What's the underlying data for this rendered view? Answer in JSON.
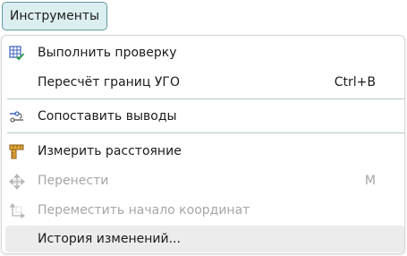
{
  "menubar": {
    "tools_label": "Инструменты"
  },
  "menu": {
    "items": [
      {
        "label": "Выполнить проверку",
        "shortcut": "",
        "icon": "table-check-icon",
        "enabled": true
      },
      {
        "label": "Пересчёт границ УГО",
        "shortcut": "Ctrl+B",
        "icon": "",
        "enabled": true
      },
      {
        "label": "Сопоставить выводы",
        "shortcut": "",
        "icon": "link-pins-icon",
        "enabled": true
      },
      {
        "label": "Измерить расстояние",
        "shortcut": "",
        "icon": "ruler-icon",
        "enabled": true
      },
      {
        "label": "Перенести",
        "shortcut": "M",
        "icon": "move-icon",
        "enabled": false
      },
      {
        "label": "Переместить начало координат",
        "shortcut": "",
        "icon": "origin-icon",
        "enabled": false
      },
      {
        "label": "История изменений...",
        "shortcut": "",
        "icon": "",
        "enabled": true,
        "highlighted": true
      }
    ]
  },
  "colors": {
    "accent": "#5e9aa1",
    "button_bg": "#dceff0",
    "disabled_text": "#a6a6a6",
    "highlight_bg": "#ececec",
    "separator": "#b4c7c9"
  }
}
